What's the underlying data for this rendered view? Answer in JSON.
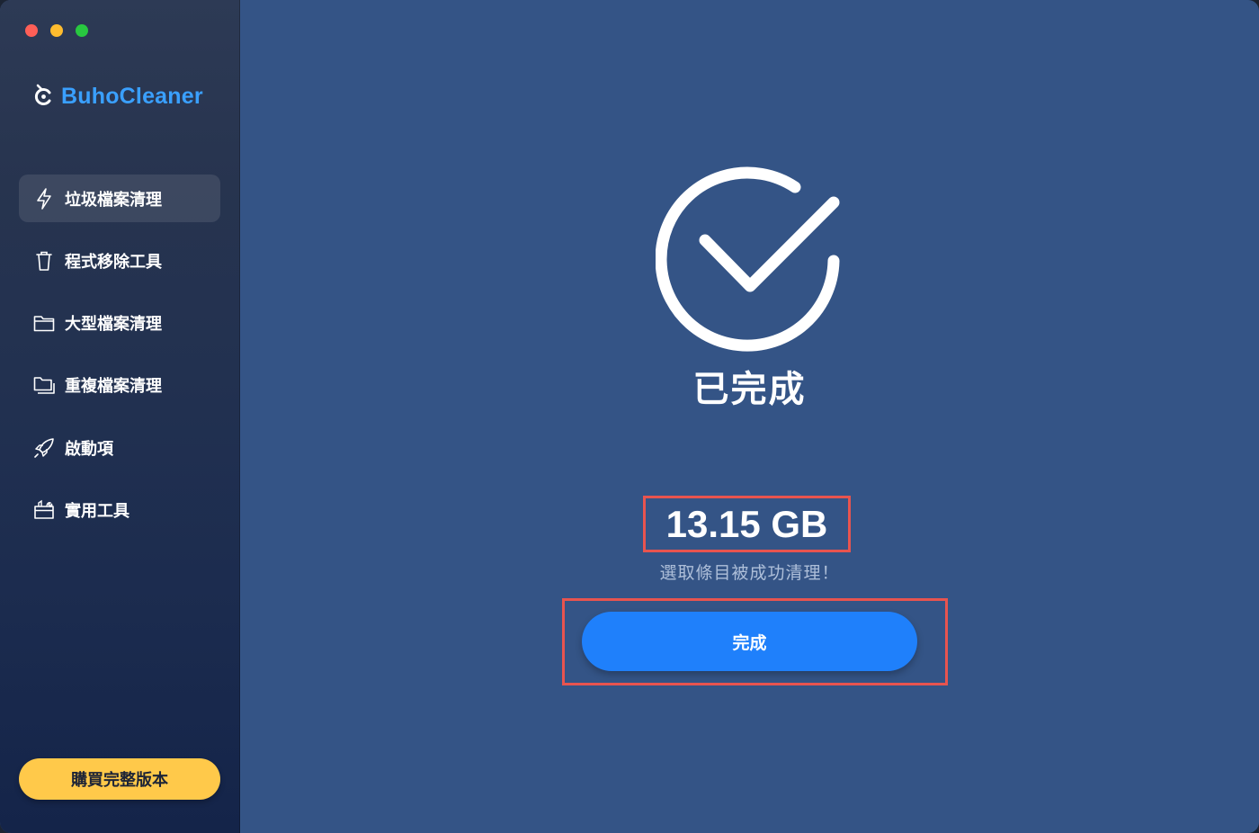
{
  "app": {
    "name": "BuhoCleaner"
  },
  "sidebar": {
    "items": [
      {
        "label": "垃圾檔案清理",
        "icon": "lightning-icon",
        "active": true
      },
      {
        "label": "程式移除工具",
        "icon": "trash-icon",
        "active": false
      },
      {
        "label": "大型檔案清理",
        "icon": "folder-icon",
        "active": false
      },
      {
        "label": "重複檔案清理",
        "icon": "duplicate-folder-icon",
        "active": false
      },
      {
        "label": "啟動項",
        "icon": "rocket-icon",
        "active": false
      },
      {
        "label": "實用工具",
        "icon": "toolbox-icon",
        "active": false
      }
    ],
    "buy_label": "購買完整版本"
  },
  "main": {
    "status_title": "已完成",
    "cleaned_size": "13.15 GB",
    "subtitle": "選取條目被成功清理！",
    "finish_label": "完成"
  },
  "colors": {
    "main_bg": "#345486",
    "accent_blue": "#1f80fb",
    "brand_blue": "#3aa0ff",
    "buy_yellow": "#ffc94a",
    "highlight_red": "#e8544f"
  }
}
